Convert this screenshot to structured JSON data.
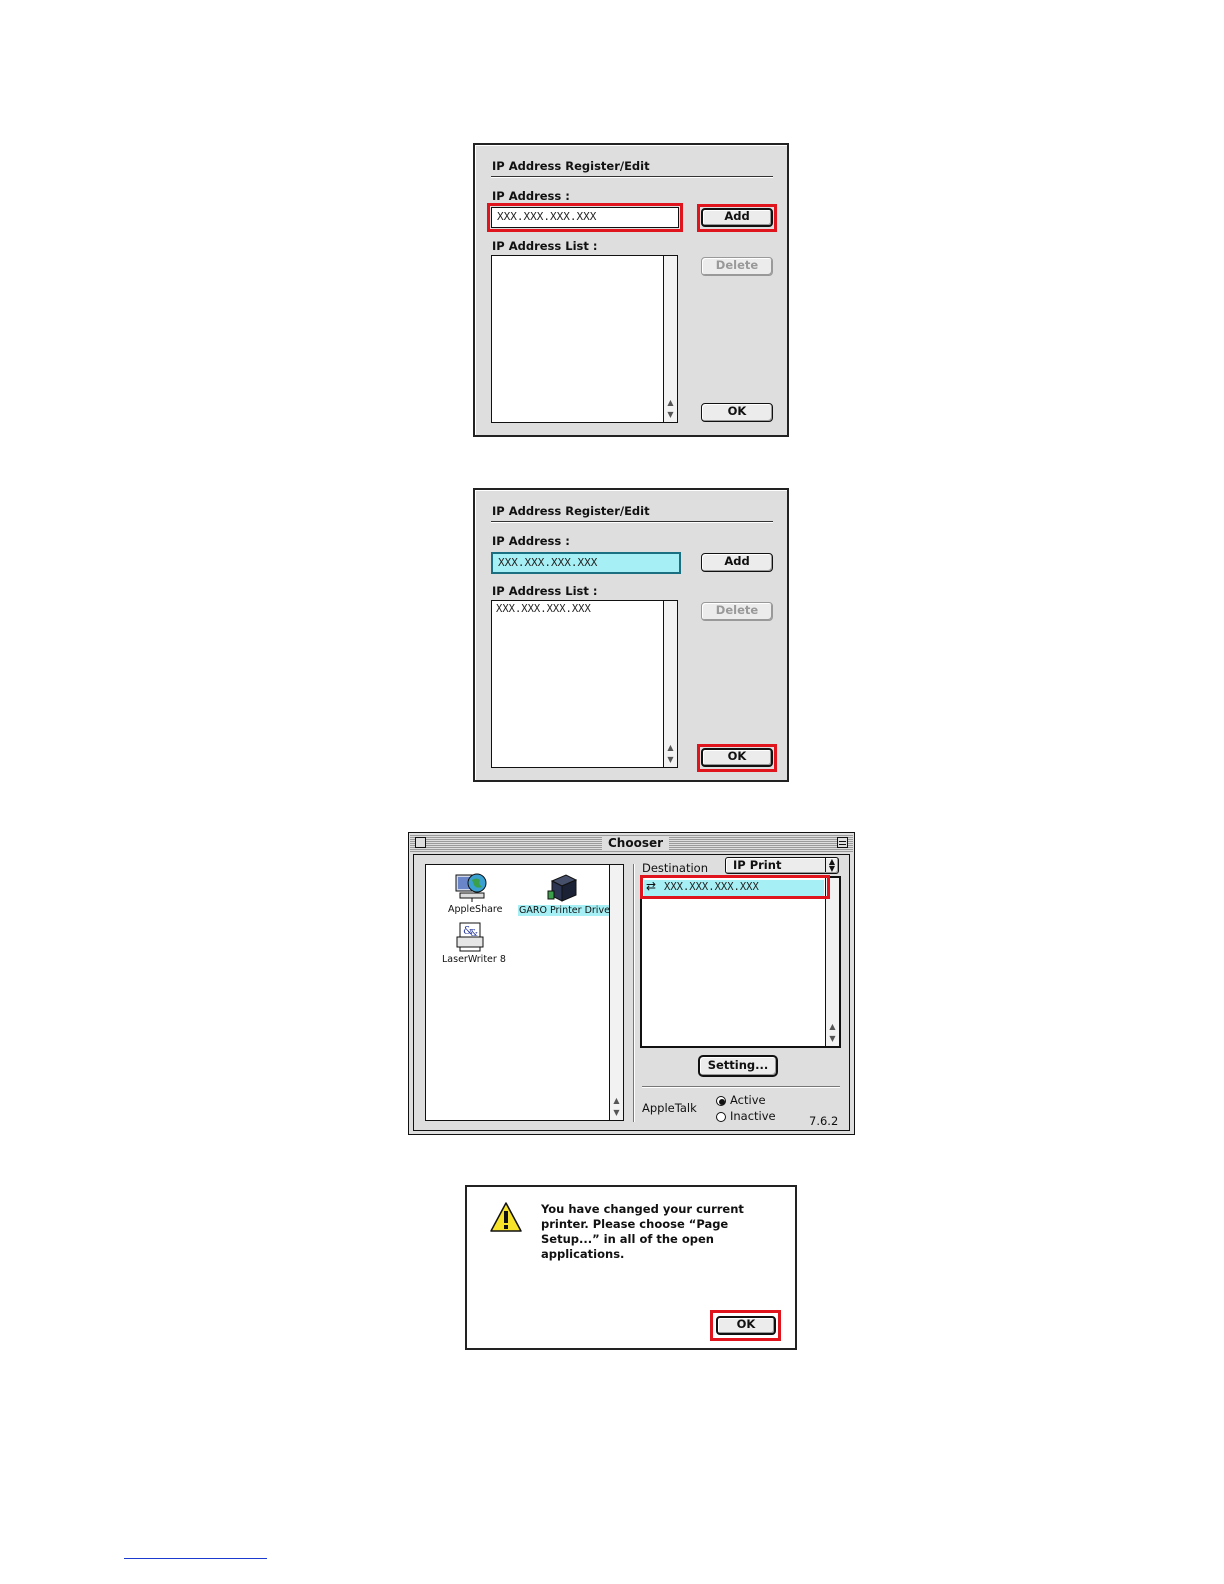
{
  "dialog1": {
    "title": "IP Address Register/Edit",
    "ip_label": "IP Address :",
    "ip_value": "XXX.XXX.XXX.XXX",
    "list_label": "IP Address List :",
    "add_label": "Add",
    "delete_label": "Delete",
    "ok_label": "OK",
    "list_items": []
  },
  "dialog2": {
    "title": "IP Address Register/Edit",
    "ip_label": "IP Address :",
    "ip_value": "XXX.XXX.XXX.XXX",
    "list_label": "IP Address List :",
    "add_label": "Add",
    "delete_label": "Delete",
    "ok_label": "OK",
    "list_items": [
      "XXX.XXX.XXX.XXX"
    ]
  },
  "chooser": {
    "title": "Chooser",
    "drivers": [
      {
        "label": "AppleShare",
        "icon": "appleshare-icon"
      },
      {
        "label": "GARO Printer Driver",
        "icon": "printer-driver-icon",
        "selected": true
      },
      {
        "label": "LaserWriter 8",
        "icon": "laserwriter-icon"
      }
    ],
    "destination_label": "Destination",
    "destination_value": "IP Print",
    "destination_items": [
      "XXX.XXX.XXX.XXX"
    ],
    "setting_label": "Setting...",
    "appletalk_label": "AppleTalk",
    "active_label": "Active",
    "inactive_label": "Inactive",
    "appletalk_state": "Active",
    "version": "7.6.2"
  },
  "alert": {
    "message": "You have changed your current printer. Please choose “Page Setup...” in all of the open applications.",
    "ok_label": "OK",
    "icon": "warning-icon"
  },
  "colors": {
    "highlight": "#a6f0f5",
    "callout_red": "#e0141c",
    "dialog_gray": "#dedede"
  }
}
